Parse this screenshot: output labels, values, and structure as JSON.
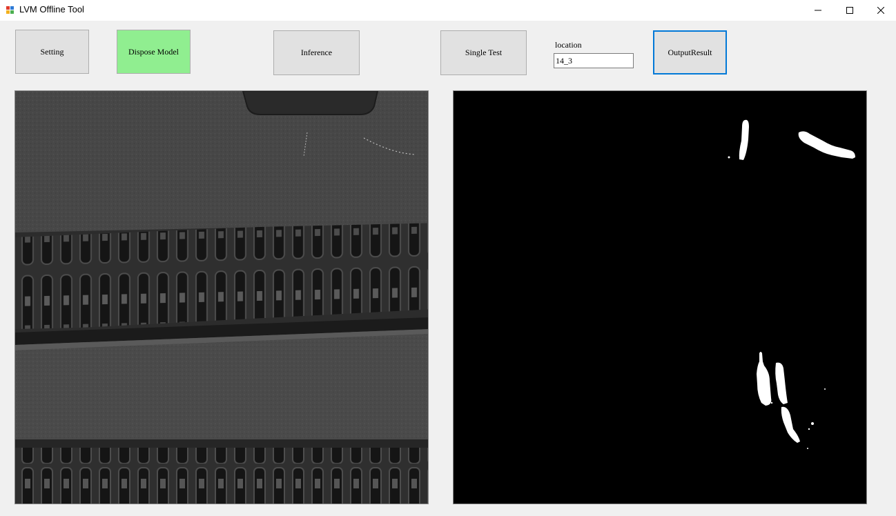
{
  "window": {
    "title": "LVM Offline Tool"
  },
  "toolbar": {
    "setting_label": "Setting",
    "dispose_model_label": "Dispose Model",
    "inference_label": "Inference",
    "single_test_label": "Single Test",
    "output_result_label": "OutputResult"
  },
  "location": {
    "label": "location",
    "value": "14_3"
  },
  "colors": {
    "dispose_button_bg": "#90ee90",
    "focus_border": "#0078d7",
    "mask_bg": "#000000",
    "mask_fg": "#ffffff"
  },
  "icons": [
    "app-icon",
    "minimize-icon",
    "maximize-icon",
    "close-icon"
  ]
}
